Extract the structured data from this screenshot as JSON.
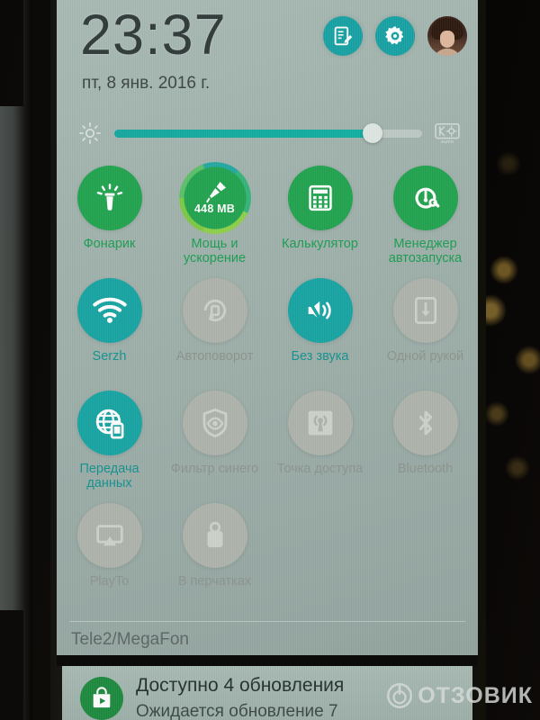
{
  "header": {
    "time": "23:37",
    "date": "пт, 8 янв. 2016 г.",
    "icons": [
      {
        "name": "edit-notes-icon",
        "label": "Изменить"
      },
      {
        "name": "settings-gear-icon",
        "label": "Настройки"
      },
      {
        "name": "user-avatar",
        "label": "Пользователь"
      }
    ]
  },
  "brightness": {
    "left_icon": "brightness-sun-icon",
    "right_icon": "auto-brightness-icon",
    "right_icon_label": "AUTO",
    "value_percent": 84,
    "accent": "#14a9a0"
  },
  "colors": {
    "active_green": "#21a44f",
    "active_teal": "#17a5a3",
    "inactive_gray": "#aeb3ab",
    "panel_bg": "#a2b3ad"
  },
  "toggles": [
    [
      {
        "label": "Фонарик",
        "icon": "flashlight-icon",
        "state": "green",
        "badge": ""
      },
      {
        "label": "Мощь и ускорение",
        "icon": "boost-brush-icon",
        "state": "green",
        "badge": "448 MB"
      },
      {
        "label": "Калькулятор",
        "icon": "calculator-icon",
        "state": "green",
        "badge": ""
      },
      {
        "label": "Менеджер автозапуска",
        "icon": "autostart-manager-icon",
        "state": "green",
        "badge": ""
      }
    ],
    [
      {
        "label": "Serzh",
        "icon": "wifi-icon",
        "state": "teal",
        "badge": ""
      },
      {
        "label": "Автоповорот",
        "icon": "auto-rotate-icon",
        "state": "off",
        "badge": ""
      },
      {
        "label": "Без звука",
        "icon": "mute-speaker-icon",
        "state": "teal",
        "badge": ""
      },
      {
        "label": "Одной рукой",
        "icon": "one-hand-mode-icon",
        "state": "off",
        "badge": ""
      }
    ],
    [
      {
        "label": "Передача данных",
        "icon": "mobile-data-icon",
        "state": "teal",
        "badge": ""
      },
      {
        "label": "Фильтр синего",
        "icon": "blue-light-filter-icon",
        "state": "off",
        "badge": ""
      },
      {
        "label": "Точка доступа",
        "icon": "hotspot-icon",
        "state": "off",
        "badge": ""
      },
      {
        "label": "Bluetooth",
        "icon": "bluetooth-icon",
        "state": "off",
        "badge": ""
      }
    ],
    [
      {
        "label": "PlayTo",
        "icon": "cast-playto-icon",
        "state": "off",
        "badge": ""
      },
      {
        "label": "В перчатках",
        "icon": "glove-mode-icon",
        "state": "off",
        "badge": ""
      },
      {
        "label": "",
        "icon": "",
        "state": "empty",
        "badge": ""
      },
      {
        "label": "",
        "icon": "",
        "state": "empty",
        "badge": ""
      }
    ]
  ],
  "carrier": "Tele2/MegaFon",
  "notification": {
    "icon": "play-store-icon",
    "title": "Доступно 4 обновления",
    "subtitle": "Ожидается обновление 7"
  },
  "watermark": {
    "text": "ОТЗОВИК",
    "icon": "otzovik-logo-icon"
  }
}
